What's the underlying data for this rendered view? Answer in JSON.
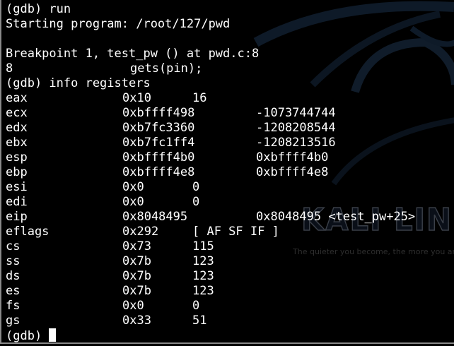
{
  "background": {
    "logo_text": "KALI LINUX",
    "tagline": "The quieter you become, the more you are able to hear."
  },
  "terminal": {
    "lines": [
      "(gdb) run",
      "Starting program: /root/127/pwd",
      "",
      "Breakpoint 1, test_pw () at pwd.c:8",
      "8\t\t  gets(pin);",
      "(gdb) info registers"
    ],
    "source_line_number": "8",
    "source_line_code": "gets(pin);",
    "registers": [
      {
        "name": "eax",
        "hex": "0x10",
        "natural": "16"
      },
      {
        "name": "ecx",
        "hex": "0xbffff498",
        "natural": "-1073744744"
      },
      {
        "name": "edx",
        "hex": "0xb7fc3360",
        "natural": "-1208208544"
      },
      {
        "name": "ebx",
        "hex": "0xb7fc1ff4",
        "natural": "-1208213516"
      },
      {
        "name": "esp",
        "hex": "0xbffff4b0",
        "natural": "0xbffff4b0"
      },
      {
        "name": "ebp",
        "hex": "0xbffff4e8",
        "natural": "0xbffff4e8"
      },
      {
        "name": "esi",
        "hex": "0x0",
        "natural": "0"
      },
      {
        "name": "edi",
        "hex": "0x0",
        "natural": "0"
      },
      {
        "name": "eip",
        "hex": "0x8048495",
        "natural": "0x8048495 <test_pw+25>"
      },
      {
        "name": "eflags",
        "hex": "0x292",
        "natural": "[ AF SF IF ]"
      },
      {
        "name": "cs",
        "hex": "0x73",
        "natural": "115"
      },
      {
        "name": "ss",
        "hex": "0x7b",
        "natural": "123"
      },
      {
        "name": "ds",
        "hex": "0x7b",
        "natural": "123"
      },
      {
        "name": "es",
        "hex": "0x7b",
        "natural": "123"
      },
      {
        "name": "fs",
        "hex": "0x0",
        "natural": "0"
      },
      {
        "name": "gs",
        "hex": "0x33",
        "natural": "51"
      }
    ],
    "prompt": "(gdb)"
  }
}
